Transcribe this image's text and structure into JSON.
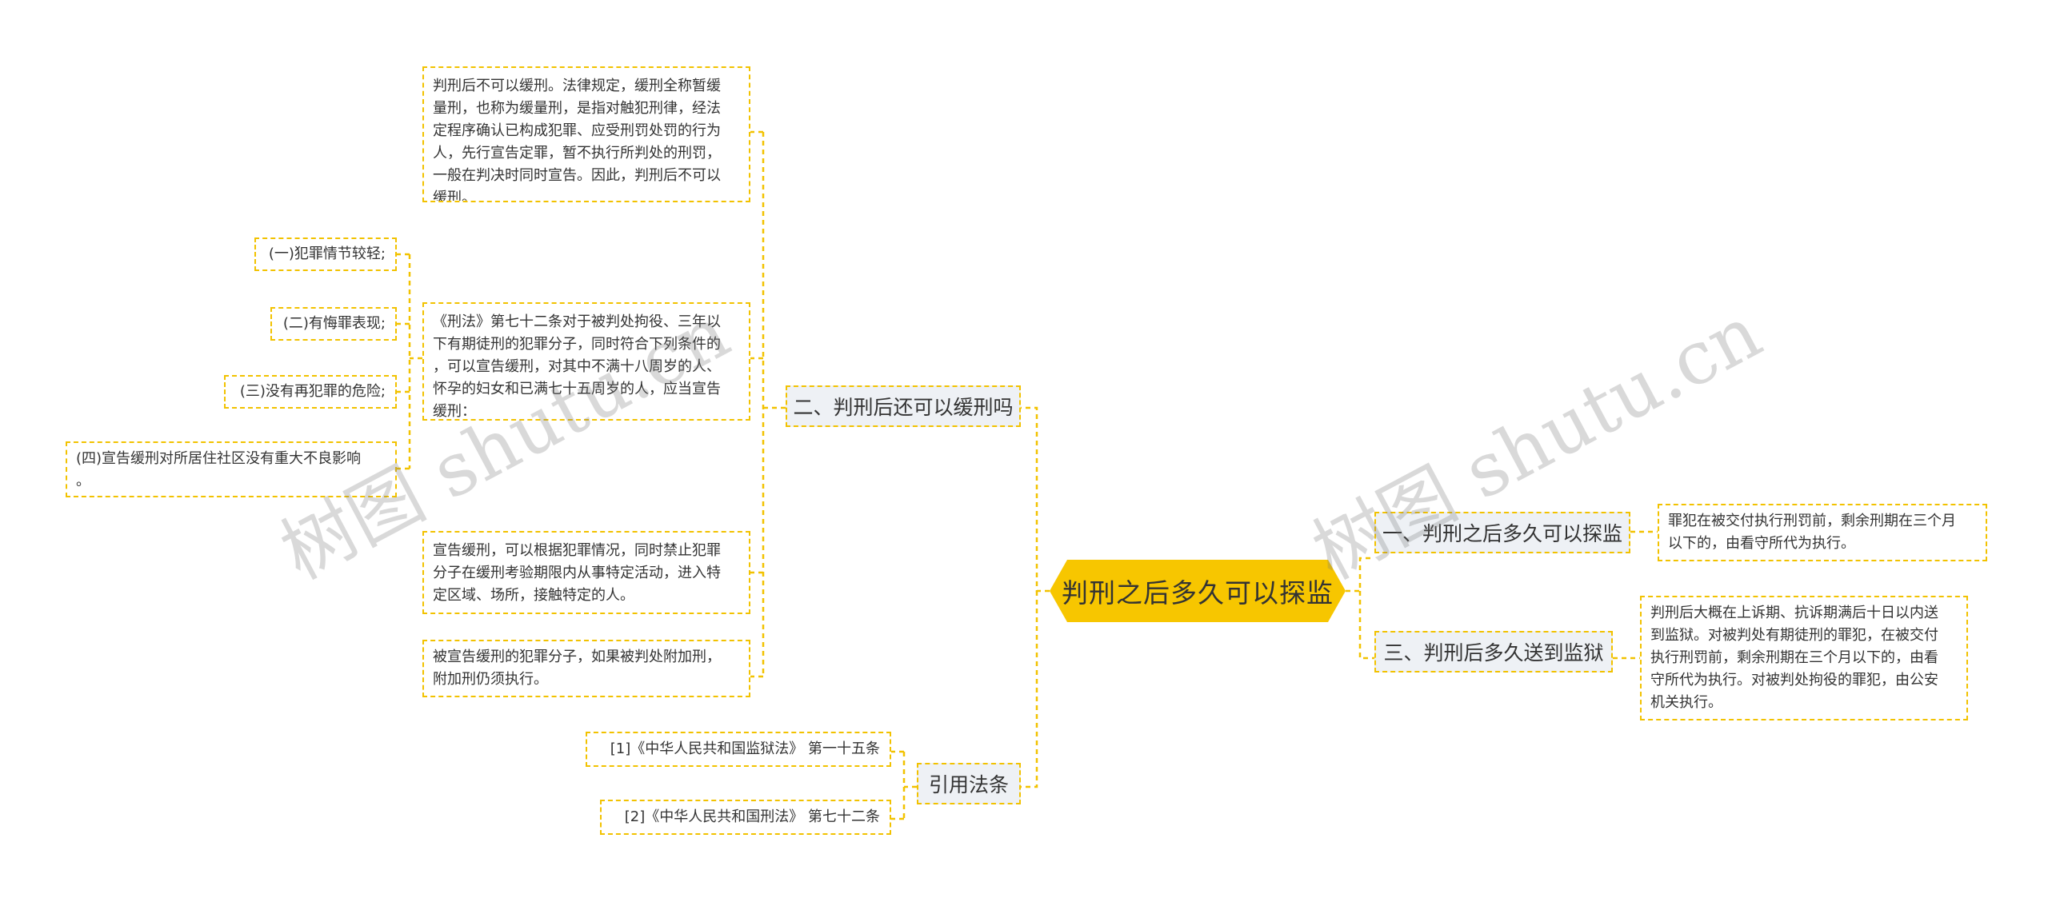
{
  "root": {
    "label": "判刑之后多久可以探监"
  },
  "branches": {
    "b1": {
      "label": "一、判刑之后多久可以探监",
      "text": "罪犯在被交付执行刑罚前，剩余刑期在三个月\n以下的，由看守所代为执行。"
    },
    "b2": {
      "label": "二、判刑后还可以缓刑吗",
      "leaf1": "判刑后不可以缓刑。法律规定，缓刑全称暂缓\n量刑，也称为缓量刑，是指对触犯刑律，经法\n定程序确认已构成犯罪、应受刑罚处罚的行为\n人，先行宣告定罪，暂不执行所判处的刑罚，\n一般在判决时同时宣告。因此，判刑后不可以\n缓刑。",
      "leaf2": "《刑法》第七十二条对于被判处拘役、三年以\n下有期徒刑的犯罪分子，同时符合下列条件的\n，可以宣告缓刑，对其中不满十八周岁的人、\n怀孕的妇女和已满七十五周岁的人，应当宣告\n缓刑：",
      "conditions": [
        "(一)犯罪情节较轻;",
        "(二)有悔罪表现;",
        "(三)没有再犯罪的危险;",
        "(四)宣告缓刑对所居住社区没有重大不良影响\n。"
      ],
      "leaf3": "宣告缓刑，可以根据犯罪情况，同时禁止犯罪\n分子在缓刑考验期限内从事特定活动，进入特\n定区域、场所，接触特定的人。",
      "leaf4": "被宣告缓刑的犯罪分子，如果被判处附加刑，\n附加刑仍须执行。"
    },
    "b3": {
      "label": "三、判刑后多久送到监狱",
      "text": "判刑后大概在上诉期、抗诉期满后十日以内送\n到监狱。对被判处有期徒刑的罪犯，在被交付\n执行刑罚前，剩余刑期在三个月以下的，由看\n守所代为执行。对被判处拘役的罪犯，由公安\n机关执行。"
    },
    "b4": {
      "label": "引用法条",
      "refs": [
        "[1]《中华人民共和国监狱法》 第一十五条",
        "[2]《中华人民共和国刑法》 第七十二条"
      ]
    }
  },
  "watermarks": [
    "树图 shutu.cn",
    "树图 shutu.cn"
  ],
  "colors": {
    "root": "#f7c600",
    "branch_fill": "#eef1f5",
    "line": "#f2c200"
  }
}
